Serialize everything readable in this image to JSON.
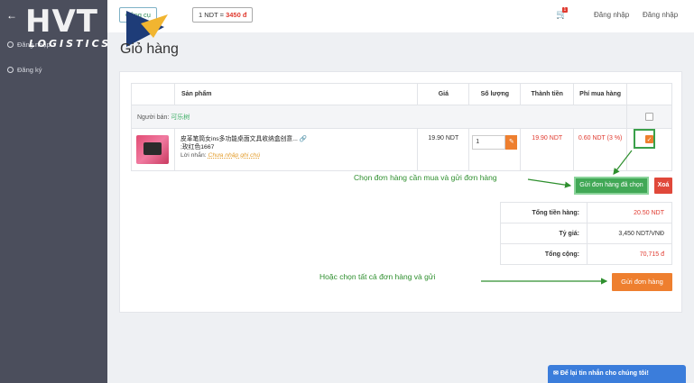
{
  "sidebar": {
    "items": [
      {
        "label": "Đăng nhập"
      },
      {
        "label": "Đăng ký"
      }
    ]
  },
  "logo": {
    "line1": "HVT",
    "line2": "LOGISTICS"
  },
  "topbar": {
    "tool_label": "Công cụ",
    "rate_prefix": "1 NDT = ",
    "rate_value": "3450 đ",
    "cart_count": "1",
    "login": "Đăng nhập",
    "register": "Đăng nhập"
  },
  "page": {
    "title": "Giỏ hàng"
  },
  "cart": {
    "headers": [
      "Sản phẩm",
      "Giá",
      "Số lượng",
      "Thành tiền",
      "Phí mua hàng"
    ],
    "seller_label": "Người bán:",
    "seller_name": "可乐树",
    "item": {
      "name": "皮革笔筒女ins多功能桌面文具收纳盒创意...",
      "variant": ";玫红色1667",
      "note_label": "Lời nhắn:",
      "note_placeholder": "Chưa nhập ghi chú",
      "price": "19.90 NDT",
      "quantity": "1",
      "total": "19.90 NDT",
      "fee": "0.60 NDT (3 %)",
      "selected": true
    }
  },
  "actions": {
    "send_selected": "Gửi đơn hàng đã chọn",
    "delete": "Xoá",
    "send_all": "Gửi đơn hàng"
  },
  "totals": [
    {
      "label": "Tổng tiền hàng:",
      "value": "20.50 NDT"
    },
    {
      "label": "Tỷ giá:",
      "value": "3,450 NDT/VNĐ"
    },
    {
      "label": "Tổng cộng:",
      "value": "70,715 đ"
    }
  ],
  "annotations": {
    "select_and_send": "Chọn đơn hàng cần mua và gửi đơn hàng",
    "select_all_and_send": "Hoặc chọn tất cả đơn hàng và gửi"
  },
  "chat": {
    "label": "Để lại tin nhắn cho chúng tôi!"
  },
  "colors": {
    "accent_orange": "#ee7f2f",
    "green": "#41a856",
    "red": "#e03a2f",
    "sidebar": "#4b4e5c"
  }
}
